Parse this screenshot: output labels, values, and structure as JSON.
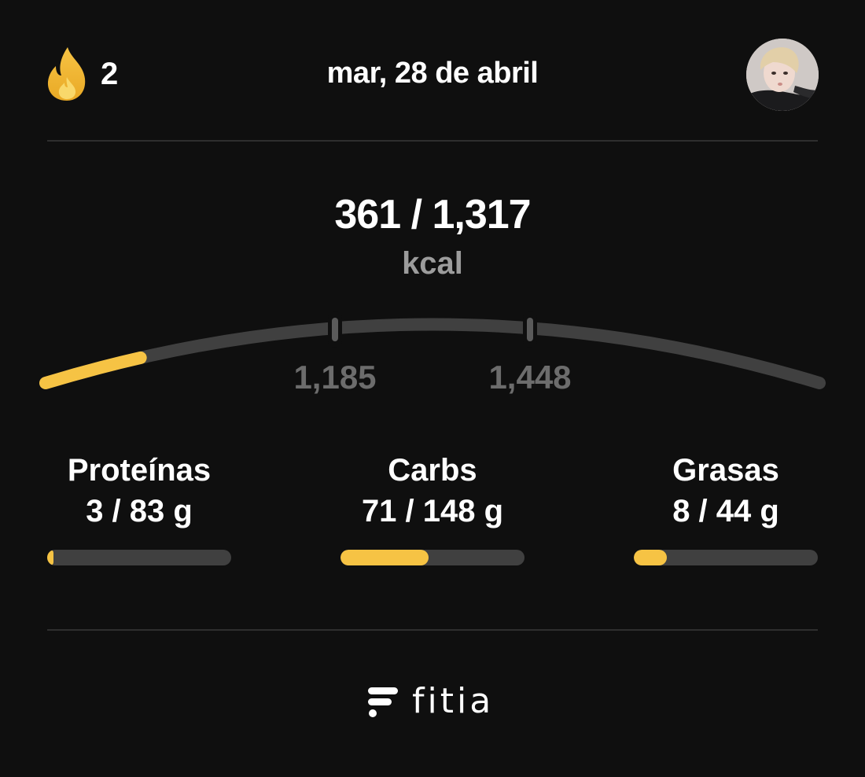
{
  "header": {
    "streak_count": "2",
    "streak_icon": "flame-icon",
    "date": "mar, 28 de abril",
    "avatar": "profile-avatar"
  },
  "calories": {
    "value": "361 / 1,317",
    "unit": "kcal",
    "consumed": 361,
    "goal": 1317,
    "progress": 0.125,
    "range_low_label": "1,185",
    "range_high_label": "1,448"
  },
  "macros": [
    {
      "name": "Proteínas",
      "value": "3 / 83 g",
      "progress": 0.036
    },
    {
      "name": "Carbs",
      "value": "71 / 148 g",
      "progress": 0.48
    },
    {
      "name": "Grasas",
      "value": "8 / 44 g",
      "progress": 0.18
    }
  ],
  "brand": {
    "name": "fitia",
    "icon": "fitia-logo-icon"
  },
  "colors": {
    "background": "#0f0f0f",
    "accent": "#f6c344",
    "track": "#404040",
    "muted_text": "#9c9c9c"
  }
}
